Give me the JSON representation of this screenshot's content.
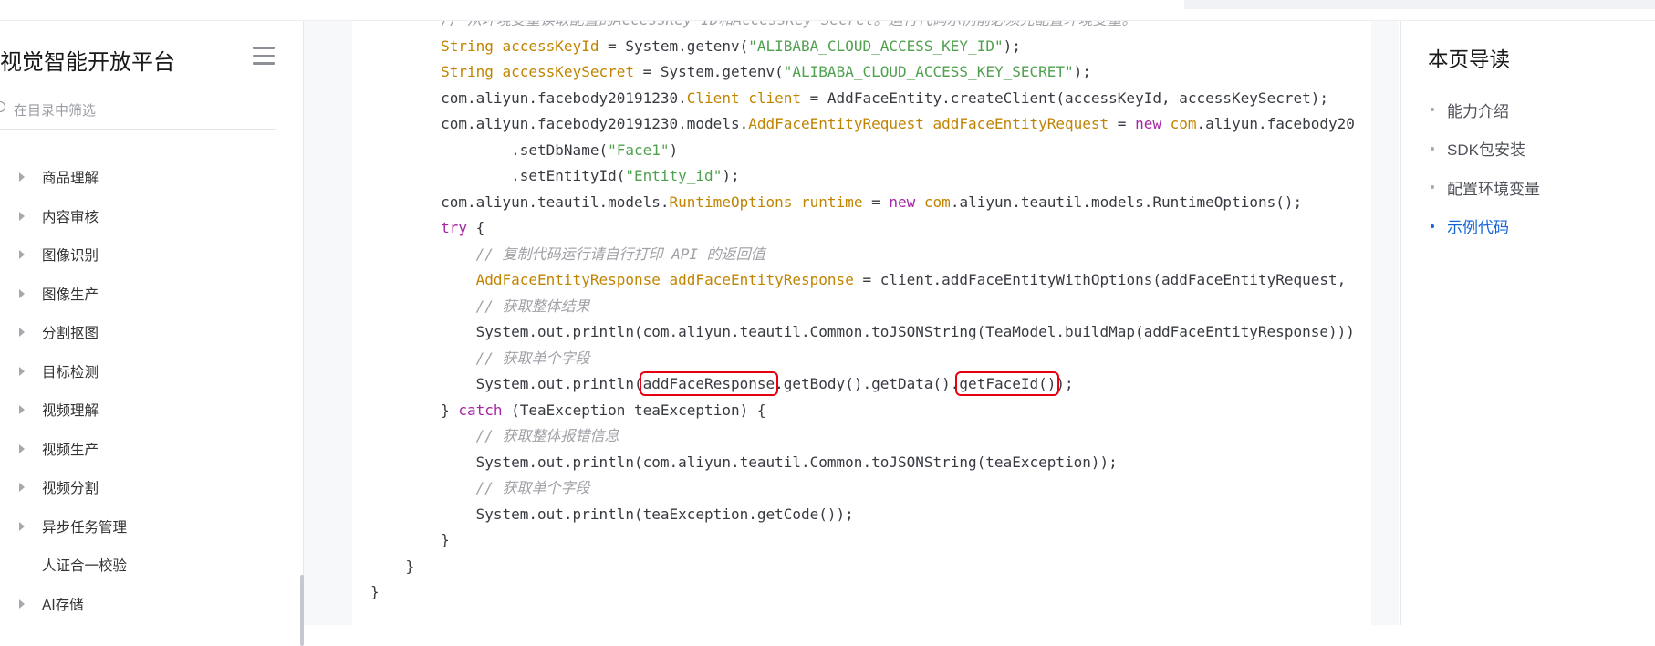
{
  "colors": {
    "accent": "#1565d8",
    "highlight_box": "#e60012",
    "code_keyword": "#a626a4",
    "code_type": "#c18401",
    "code_string": "#50a14f",
    "code_comment": "#a0a1a7"
  },
  "sidebar": {
    "title": "视觉智能开放平台",
    "menu_icon": "hamburger-menu-icon",
    "filter": {
      "icon": "search-icon",
      "placeholder": "在目录中筛选",
      "value": ""
    },
    "items": [
      {
        "label": "商品理解",
        "expandable": true
      },
      {
        "label": "内容审核",
        "expandable": true
      },
      {
        "label": "图像识别",
        "expandable": true
      },
      {
        "label": "图像生产",
        "expandable": true
      },
      {
        "label": "分割抠图",
        "expandable": true
      },
      {
        "label": "目标检测",
        "expandable": true
      },
      {
        "label": "视频理解",
        "expandable": true
      },
      {
        "label": "视频生产",
        "expandable": true
      },
      {
        "label": "视频分割",
        "expandable": true
      },
      {
        "label": "异步任务管理",
        "expandable": true
      },
      {
        "label": "人证合一校验",
        "expandable": false
      },
      {
        "label": "AI存储",
        "expandable": true
      }
    ]
  },
  "code": {
    "language": "java",
    "lines": [
      [
        [
          "        ",
          ""
        ],
        [
          "// 从环境变量读取配置的AccessKey ID和AccessKey Secret。运行代码示例前必须先配置环境变量。",
          "cm"
        ]
      ],
      [
        [
          "        ",
          ""
        ],
        [
          "String",
          "type"
        ],
        [
          " ",
          ""
        ],
        [
          "accessKeyId",
          "type"
        ],
        [
          " = System.getenv(",
          ""
        ],
        [
          "\"ALIBABA_CLOUD_ACCESS_KEY_ID\"",
          "str"
        ],
        [
          ");",
          ""
        ]
      ],
      [
        [
          "        ",
          ""
        ],
        [
          "String",
          "type"
        ],
        [
          " ",
          ""
        ],
        [
          "accessKeySecret",
          "type"
        ],
        [
          " = System.getenv(",
          ""
        ],
        [
          "\"ALIBABA_CLOUD_ACCESS_KEY_SECRET\"",
          "str"
        ],
        [
          ");",
          ""
        ]
      ],
      [
        [
          "        com.aliyun.facebody20191230.",
          ""
        ],
        [
          "Client",
          "type"
        ],
        [
          " ",
          ""
        ],
        [
          "client",
          "type"
        ],
        [
          " = AddFaceEntity.createClient(accessKeyId, accessKeySecret);",
          ""
        ]
      ],
      [
        [
          "        com.aliyun.facebody20191230.models.",
          ""
        ],
        [
          "AddFaceEntityRequest",
          "type"
        ],
        [
          " ",
          ""
        ],
        [
          "addFaceEntityRequest",
          "type"
        ],
        [
          " = ",
          ""
        ],
        [
          "new",
          "kw"
        ],
        [
          " ",
          ""
        ],
        [
          "com",
          "type"
        ],
        [
          ".aliyun.facebody20",
          ""
        ]
      ],
      [
        [
          "                .setDbName(",
          ""
        ],
        [
          "\"Face1\"",
          "str"
        ],
        [
          ")",
          ""
        ]
      ],
      [
        [
          "                .setEntityId(",
          ""
        ],
        [
          "\"Entity_id\"",
          "str"
        ],
        [
          ");",
          ""
        ]
      ],
      [
        [
          "        com.aliyun.teautil.models.",
          ""
        ],
        [
          "RuntimeOptions",
          "type"
        ],
        [
          " ",
          ""
        ],
        [
          "runtime",
          "type"
        ],
        [
          " = ",
          ""
        ],
        [
          "new",
          "kw"
        ],
        [
          " ",
          ""
        ],
        [
          "com",
          "type"
        ],
        [
          ".aliyun.teautil.models.RuntimeOptions();",
          ""
        ]
      ],
      [
        [
          "        ",
          ""
        ],
        [
          "try",
          "kw"
        ],
        [
          " {",
          ""
        ]
      ],
      [
        [
          "            ",
          ""
        ],
        [
          "// 复制代码运行请自行打印 API 的返回值",
          "cm"
        ]
      ],
      [
        [
          "            ",
          ""
        ],
        [
          "AddFaceEntityResponse",
          "type"
        ],
        [
          " ",
          ""
        ],
        [
          "addFaceEntityResponse",
          "type"
        ],
        [
          " = client.addFaceEntityWithOptions(addFaceEntityRequest,",
          ""
        ]
      ],
      [
        [
          "            ",
          ""
        ],
        [
          "// 获取整体结果",
          "cm"
        ]
      ],
      [
        [
          "            System.out.println(com.aliyun.teautil.Common.toJSONString(TeaModel.buildMap(addFaceEntityResponse)))",
          ""
        ]
      ],
      [
        [
          "            ",
          ""
        ],
        [
          "// 获取单个字段",
          "cm"
        ]
      ],
      [
        [
          "            System.out.println(",
          ""
        ],
        [
          "addFaceResponse",
          "hl"
        ],
        [
          ".getBody().getData().",
          ""
        ],
        [
          "getFaceId()",
          "hl"
        ],
        [
          ");",
          ""
        ]
      ],
      [
        [
          "        } ",
          ""
        ],
        [
          "catch",
          "kw"
        ],
        [
          " (TeaException teaException) {",
          ""
        ]
      ],
      [
        [
          "            ",
          ""
        ],
        [
          "// 获取整体报错信息",
          "cm"
        ]
      ],
      [
        [
          "            System.out.println(com.aliyun.teautil.Common.toJSONString(teaException));",
          ""
        ]
      ],
      [
        [
          "            ",
          ""
        ],
        [
          "// 获取单个字段",
          "cm"
        ]
      ],
      [
        [
          "            System.out.println(teaException.getCode());",
          ""
        ]
      ],
      [
        [
          "        }",
          ""
        ]
      ],
      [
        [
          "    }",
          ""
        ]
      ],
      [
        [
          "}",
          ""
        ]
      ]
    ]
  },
  "toc": {
    "title": "本页导读",
    "items": [
      {
        "label": "能力介绍",
        "active": false
      },
      {
        "label": "SDK包安装",
        "active": false
      },
      {
        "label": "配置环境变量",
        "active": false
      },
      {
        "label": "示例代码",
        "active": true
      }
    ]
  }
}
